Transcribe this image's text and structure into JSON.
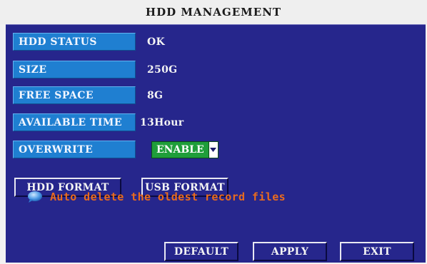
{
  "title": "HDD MANAGEMENT",
  "fields": [
    {
      "label": "HDD STATUS",
      "value": "OK"
    },
    {
      "label": "SIZE",
      "value": "250G"
    },
    {
      "label": "FREE SPACE",
      "value": "8G"
    },
    {
      "label": "AVAILABLE TIME",
      "value": "13Hour"
    }
  ],
  "overwrite": {
    "label": "OVERWRITE",
    "selected": "ENABLE"
  },
  "buttons": {
    "hdd_format": "HDD FORMAT",
    "usb_format": "USB FORMAT",
    "default": "DEFAULT",
    "apply": "APPLY",
    "exit": "EXIT"
  },
  "notice": "Auto delete the oldest record files",
  "colors": {
    "panel": "#26268c",
    "label_bg": "#1f7fd1",
    "select_bg": "#1f9e3a",
    "notice_text": "#e96b1e"
  },
  "icons": {
    "notice": "speech-bubble-icon",
    "dropdown": "chevron-down-icon"
  }
}
